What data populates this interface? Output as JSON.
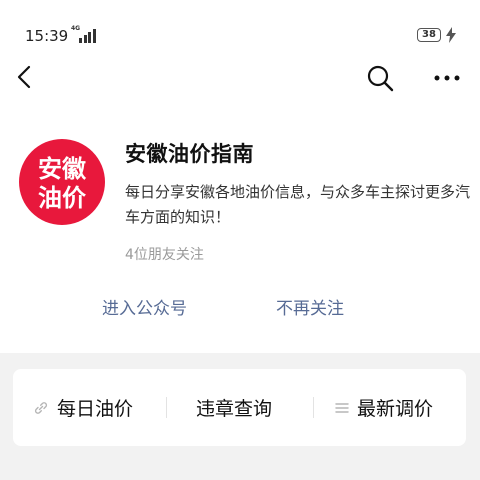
{
  "status_bar": {
    "time": "15:39",
    "network": "4G",
    "battery": "38"
  },
  "nav": {
    "back_icon": "back-arrow-icon",
    "search_icon": "search-icon",
    "more_icon": "more-dots-icon"
  },
  "profile": {
    "logo_text_line1": "安徽",
    "logo_text_line2": "油价",
    "logo_color": "#e8183c",
    "name": "安徽油价指南",
    "description": "每日分享安徽各地油价信息，与众多车主探讨更多汽车方面的知识！",
    "friends_follow": "4位朋友关注"
  },
  "actions": {
    "enter": "进入公众号",
    "unfollow": "不再关注",
    "color": "#576b95"
  },
  "menu": [
    {
      "label": "每日油价",
      "icon": "link-icon"
    },
    {
      "label": "违章查询",
      "icon": ""
    },
    {
      "label": "最新调价",
      "icon": "list-icon"
    }
  ]
}
